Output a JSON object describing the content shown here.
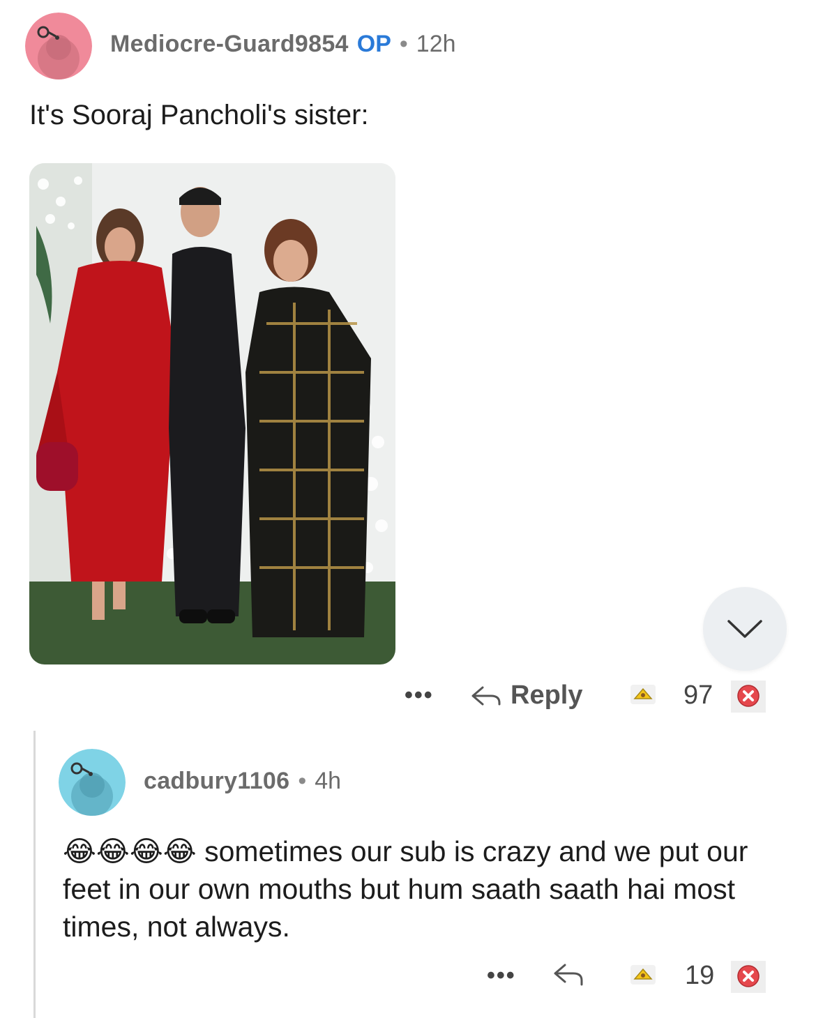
{
  "post": {
    "username": "Mediocre-Guard9854",
    "op_badge": "OP",
    "separator": "•",
    "time": "12h",
    "text": "It's Sooraj Pancholi's sister:",
    "avatar_color": "#f08a9a",
    "image_alt": "Three people posing at an event: woman in red dress, man in black suit, woman in black and gold outfit",
    "actions": {
      "more": "•••",
      "reply_label": "Reply",
      "score": "97"
    }
  },
  "reply": {
    "username": "cadbury1106",
    "separator": "•",
    "time": "4h",
    "emojis": [
      "😂",
      "😂",
      "😂",
      "😂"
    ],
    "text": "sometimes our sub is crazy and we put our feet in our own mouths but hum saath saath hai most times, not always.",
    "avatar_color": "#7fd3e6",
    "actions": {
      "more": "•••",
      "score": "19"
    }
  },
  "colors": {
    "op_blue": "#2a7ad8",
    "meta_gray": "#6b6b6b",
    "downvote_red": "#e5484d",
    "upvote_gold": "#f5c518"
  },
  "icons": [
    "collapse-chevron-icon",
    "reply-arrow-icon",
    "award-upvote-icon",
    "downvote-x-icon",
    "more-dots-icon"
  ]
}
